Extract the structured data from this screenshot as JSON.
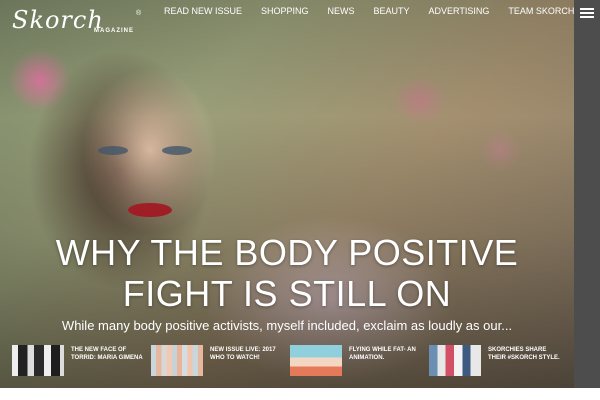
{
  "logo": {
    "script": "Skorch",
    "registered": "®",
    "sub": "MAGAZINE"
  },
  "nav": [
    {
      "label": "READ NEW ISSUE"
    },
    {
      "label": "SHOPPING"
    },
    {
      "label": "NEWS"
    },
    {
      "label": "BEAUTY"
    },
    {
      "label": "ADVERTISING"
    },
    {
      "label": "TEAM SKORCH"
    }
  ],
  "menu": {
    "icon": "hamburger-menu-icon"
  },
  "hero": {
    "headline_line1": "WHY THE BODY POSITIVE",
    "headline_line2": "FIGHT IS STILL ON",
    "excerpt": "While many body positive activists, myself included, exclaim as loudly as our..."
  },
  "cards": [
    {
      "title": "THE NEW FACE OF TORRID: MARIA GIMENA"
    },
    {
      "title": "NEW ISSUE LIVE: 2017 WHO TO WATCH!"
    },
    {
      "title": "FLYING WHILE FAT- AN ANIMATION."
    },
    {
      "title": "SKORCHIES SHARE THEIR #SKORCH STYLE."
    }
  ],
  "colors": {
    "rail": "#4d4d4d",
    "lips": "#b5222a",
    "text": "#ffffff"
  }
}
